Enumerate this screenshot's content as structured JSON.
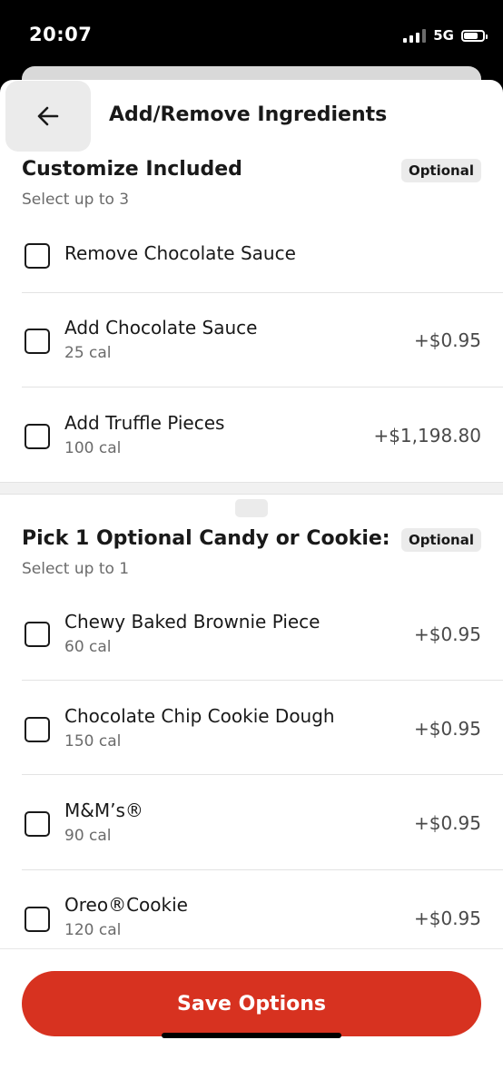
{
  "status_bar": {
    "time": "20:07",
    "network": "5G",
    "icons": [
      "signal-icon",
      "battery-icon"
    ]
  },
  "header": {
    "title": "Add/Remove Ingredients",
    "back_icon": "arrow-left-icon"
  },
  "sections": [
    {
      "title": "Customize Included",
      "badge": "Optional",
      "subtitle": "Select up to 3",
      "options": [
        {
          "name": "Remove Chocolate Sauce",
          "cal": "",
          "price": "",
          "checked": false
        },
        {
          "name": "Add Chocolate Sauce",
          "cal": "25 cal",
          "price": "+$0.95",
          "checked": false
        },
        {
          "name": "Add Truffle Pieces",
          "cal": "100 cal",
          "price": "+$1,198.80",
          "checked": false
        }
      ]
    },
    {
      "title": "Pick 1 Optional Candy or Cookie:",
      "badge": "Optional",
      "subtitle": "Select up to 1",
      "options": [
        {
          "name": "Chewy Baked Brownie Piece",
          "cal": "60 cal",
          "price": "+$0.95",
          "checked": false
        },
        {
          "name": "Chocolate Chip Cookie Dough",
          "cal": "150 cal",
          "price": "+$0.95",
          "checked": false
        },
        {
          "name": "M&M’s®",
          "cal": "90 cal",
          "price": "+$0.95",
          "checked": false
        },
        {
          "name": "Oreo®Cookie",
          "cal": "120 cal",
          "price": "+$0.95",
          "checked": false
        }
      ]
    }
  ],
  "footer": {
    "save_label": "Save Options"
  },
  "colors": {
    "accent": "#d73220",
    "badge_bg": "#ebebeb",
    "muted_text": "#6b6b6b"
  }
}
